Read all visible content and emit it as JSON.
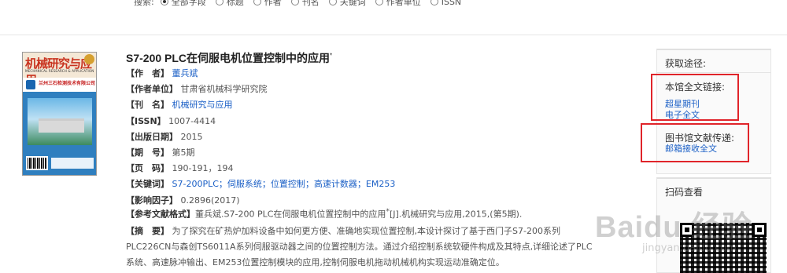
{
  "search": {
    "label": "搜索:",
    "options": [
      {
        "label": "全部字段",
        "selected": true
      },
      {
        "label": "标题",
        "selected": false
      },
      {
        "label": "作者",
        "selected": false
      },
      {
        "label": "刊名",
        "selected": false
      },
      {
        "label": "关键词",
        "selected": false
      },
      {
        "label": "作者单位",
        "selected": false
      },
      {
        "label": "ISSN",
        "selected": false
      }
    ]
  },
  "cover": {
    "journal_name": "机械研究与应用",
    "journal_en": "MECHANICAL RESEARCH & APPLICATION",
    "sponsor": "兰州三石检测技术有限公司"
  },
  "article": {
    "title": "S7-200 PLC在伺服电机位置控制中的应用",
    "title_mark": "*",
    "author_key": "【作　者】",
    "author": "董兵斌",
    "affil_key": "【作者单位】",
    "affil": "甘肃省机械科学研究院",
    "journal_key": "【刊　名】",
    "journal": "机械研究与应用",
    "issn_key": "【ISSN】",
    "issn": "1007-4414",
    "date_key": "【出版日期】",
    "date": "2015",
    "issue_key": "【期　号】",
    "issue": "第5期",
    "pages_key": "【页　码】",
    "pages": "190-191，194",
    "kw_key": "【关键词】",
    "keywords": [
      "S7-200PLC",
      "伺服系统",
      "位置控制",
      "高速计数器",
      "EM253"
    ],
    "impact_key": "【影响因子】",
    "impact": "0.2896(2017)",
    "cite_key": "【参考文献格式】",
    "cite": "董兵斌.S7-200 PLC在伺服电机位置控制中的应用",
    "cite_tail": "[J].机械研究与应用,2015,(第5期).",
    "abstract_key": "【摘　要】",
    "abstract": "为了探究在矿热炉加料设备中如何更方便、准确地实现位置控制,本设计探讨了基于西门子S7-200系列PLC226CN与森创TS6011A系列伺服驱动器之间的位置控制方法。通过介绍控制系统软硬件构成及其特点,详细论述了PLC系统、高速脉冲输出、EM253位置控制模块的应用,控制伺服电机拖动机械机构实现运动准确定位。"
  },
  "sidebar": {
    "header": "获取途径:",
    "fulltext_header": "本馆全文链接:",
    "fulltext_links": [
      "超星期刊",
      "电子全文"
    ],
    "delivery_header": "图书馆文献传递:",
    "delivery_links": [
      "邮箱接收全文"
    ],
    "qr_header": "扫码查看"
  },
  "watermark": {
    "main": "Baidu 经验",
    "sub": "jingyan.baidu.com"
  },
  "colors": {
    "link": "#1a5fc6",
    "highlight_box": "#e0242a"
  }
}
